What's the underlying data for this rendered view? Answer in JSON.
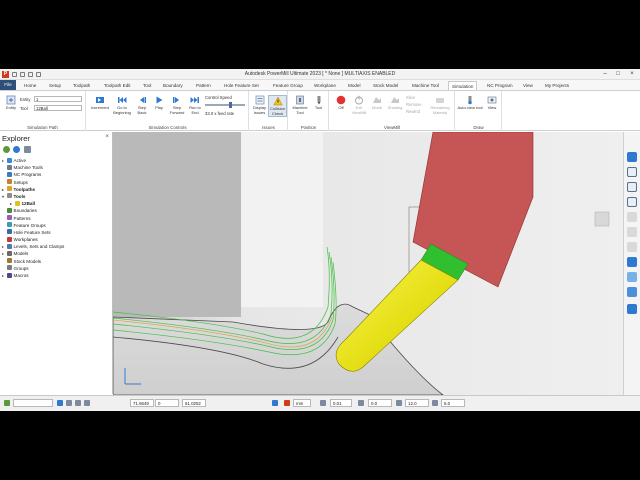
{
  "window": {
    "title": "Autodesk PowerMill Ultimate 2023   [ * None ]   MULTIAXIS ENABLED",
    "logo": "P"
  },
  "menu": {
    "tabs": [
      "File",
      "Home",
      "Setup",
      "Toolpath",
      "Toolpath Edit",
      "Tool",
      "Boundary",
      "Pattern",
      "Hole Feature Set",
      "Feature Group",
      "Workplane",
      "Model",
      "Stock Model",
      "Machine Tool",
      "Simulation",
      "NC Program",
      "View",
      "My Projects"
    ],
    "active": "Simulation"
  },
  "ribbon": {
    "simulation_path": {
      "label": "Simulation Path",
      "entity_btn": "Entity",
      "entity_label": "Entity",
      "entity_value": "1",
      "tool_label": "Tool",
      "tool_value": "12Ball"
    },
    "simulation_controls": {
      "label": "Simulation Controls",
      "increment": "Increment",
      "go_beginning": "Go to Beginning",
      "step_back": "Step Back",
      "play": "Play",
      "step_forward": "Step Forward",
      "run_to_end": "Run to End",
      "control_speed": "Control Speed",
      "feed_rate": "33.0 x feed rate"
    },
    "issues": {
      "label": "Issues",
      "display": "Display Issues",
      "collision": "Collision Check"
    },
    "position": {
      "label": "Position",
      "machine_tool": "Machine Tool",
      "tool": "Tool"
    },
    "viewmill": {
      "label": "ViewMill",
      "off": "Off",
      "exit": "Exit ViewMill",
      "mode": "Mode",
      "shading": "Shading",
      "slice": "Slice",
      "remove": "Remove",
      "rewind": "Rewind",
      "remaining": "Remaining Material"
    },
    "draw": {
      "label": "Draw",
      "auto_view": "Auto-view tool",
      "view": "View"
    }
  },
  "explorer": {
    "title": "Explorer",
    "items": [
      {
        "label": "Active",
        "indent": 0,
        "exp": "▸",
        "color": "#3c86d8",
        "bold": false
      },
      {
        "label": "Machine Tools",
        "indent": 0,
        "exp": "",
        "color": "#6b7a8c",
        "bold": false
      },
      {
        "label": "NC Programs",
        "indent": 0,
        "exp": "",
        "color": "#3a7abf",
        "bold": false
      },
      {
        "label": "Setups",
        "indent": 0,
        "exp": "",
        "color": "#c97f2e",
        "bold": false
      },
      {
        "label": "Toolpaths",
        "indent": 0,
        "exp": "▸",
        "color": "#d9a22b",
        "bold": true
      },
      {
        "label": "Tools",
        "indent": 0,
        "exp": "▾",
        "color": "#8d8d8d",
        "bold": true
      },
      {
        "label": "12Ball",
        "indent": 1,
        "exp": "▸",
        "color": "#e0c21e",
        "bold": true
      },
      {
        "label": "Boundaries",
        "indent": 0,
        "exp": "",
        "color": "#4a8c3a",
        "bold": false
      },
      {
        "label": "Patterns",
        "indent": 0,
        "exp": "",
        "color": "#9a5bbd",
        "bold": false
      },
      {
        "label": "Feature Groups",
        "indent": 0,
        "exp": "",
        "color": "#3c9bb8",
        "bold": false
      },
      {
        "label": "Hole Feature Sets",
        "indent": 0,
        "exp": "",
        "color": "#2f6ea8",
        "bold": false
      },
      {
        "label": "Workplanes",
        "indent": 0,
        "exp": "",
        "color": "#c23b3b",
        "bold": false
      },
      {
        "label": "Levels, Sets and Clamps",
        "indent": 0,
        "exp": "▸",
        "color": "#5577aa",
        "bold": false
      },
      {
        "label": "Models",
        "indent": 0,
        "exp": "▸",
        "color": "#6a6a6a",
        "bold": false
      },
      {
        "label": "Stock Models",
        "indent": 0,
        "exp": "",
        "color": "#a0792e",
        "bold": false
      },
      {
        "label": "Groups",
        "indent": 0,
        "exp": "",
        "color": "#7b7b7b",
        "bold": false
      },
      {
        "label": "Macros",
        "indent": 0,
        "exp": "▸",
        "color": "#4a4a8c",
        "bold": false
      }
    ]
  },
  "status": {
    "x": "71.6649",
    "y": "0",
    "z": "61.0252",
    "units": "mm",
    "tol": "0.01",
    "offset": "0.0",
    "diameter": "12.0",
    "step": "6.0"
  },
  "colors": {
    "accent": "#2e4f7a",
    "holder": "#c65555",
    "collet": "#2fbf2f",
    "tool": "#e6e21a"
  }
}
